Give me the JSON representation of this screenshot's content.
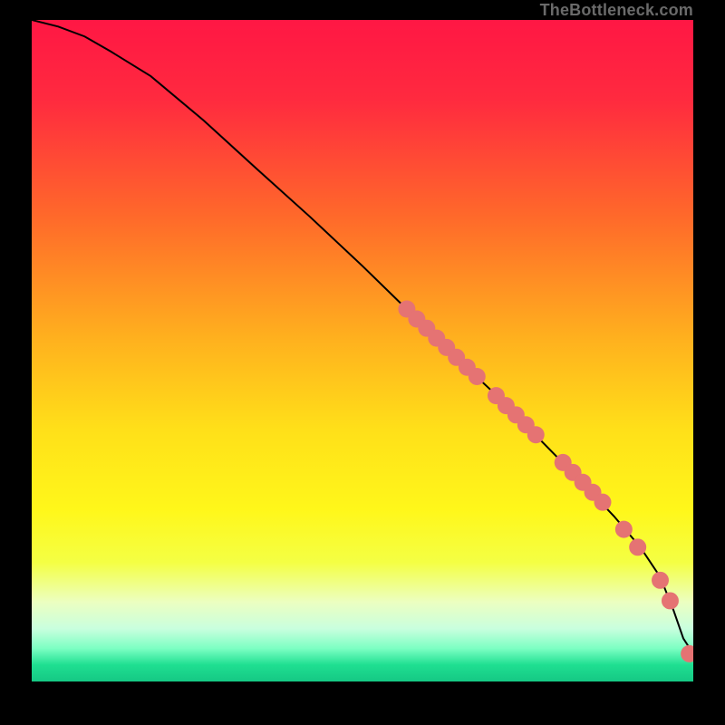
{
  "watermark": "TheBottleneck.com",
  "chart_data": {
    "type": "line",
    "title": "",
    "xlabel": "",
    "ylabel": "",
    "xlim": [
      0,
      100
    ],
    "ylim": [
      0,
      100
    ],
    "grid": false,
    "legend": false,
    "gradient_stops": [
      {
        "pos": 0.0,
        "color": "#ff1744"
      },
      {
        "pos": 0.12,
        "color": "#ff2a3f"
      },
      {
        "pos": 0.3,
        "color": "#ff6a2a"
      },
      {
        "pos": 0.48,
        "color": "#ffb01e"
      },
      {
        "pos": 0.62,
        "color": "#ffe019"
      },
      {
        "pos": 0.74,
        "color": "#fff71a"
      },
      {
        "pos": 0.82,
        "color": "#f4ff44"
      },
      {
        "pos": 0.88,
        "color": "#ecffc1"
      },
      {
        "pos": 0.92,
        "color": "#c9ffde"
      },
      {
        "pos": 0.95,
        "color": "#7cffc3"
      },
      {
        "pos": 0.975,
        "color": "#1fdf91"
      },
      {
        "pos": 1.0,
        "color": "#15c884"
      }
    ],
    "curve": {
      "x": [
        0,
        4,
        8,
        12,
        18,
        26,
        34,
        42,
        50,
        58,
        64,
        70,
        76,
        82,
        88,
        92,
        95,
        97,
        98.5,
        100
      ],
      "y": [
        100,
        99,
        97.5,
        95.2,
        91.5,
        84.8,
        77.5,
        70.3,
        62.8,
        55.0,
        49.1,
        43.5,
        37.4,
        31.3,
        25.0,
        20.3,
        15.8,
        10.8,
        6.5,
        4.2
      ]
    },
    "marker_color": "#e57373",
    "marker_radius_pct": 1.3,
    "markers": [
      {
        "x": 56.7,
        "y": 56.3
      },
      {
        "x": 58.2,
        "y": 54.8
      },
      {
        "x": 59.7,
        "y": 53.4
      },
      {
        "x": 61.2,
        "y": 51.9
      },
      {
        "x": 62.7,
        "y": 50.5
      },
      {
        "x": 64.2,
        "y": 49.0
      },
      {
        "x": 65.8,
        "y": 47.5
      },
      {
        "x": 67.3,
        "y": 46.1
      },
      {
        "x": 70.2,
        "y": 43.2
      },
      {
        "x": 71.7,
        "y": 41.7
      },
      {
        "x": 73.2,
        "y": 40.3
      },
      {
        "x": 74.7,
        "y": 38.8
      },
      {
        "x": 76.2,
        "y": 37.3
      },
      {
        "x": 80.3,
        "y": 33.1
      },
      {
        "x": 81.8,
        "y": 31.6
      },
      {
        "x": 83.3,
        "y": 30.1
      },
      {
        "x": 84.8,
        "y": 28.6
      },
      {
        "x": 86.3,
        "y": 27.1
      },
      {
        "x": 89.5,
        "y": 23.0
      },
      {
        "x": 91.6,
        "y": 20.3
      },
      {
        "x": 95.0,
        "y": 15.3
      },
      {
        "x": 96.5,
        "y": 12.2
      },
      {
        "x": 99.4,
        "y": 4.2
      },
      {
        "x": 101.0,
        "y": 4.3
      }
    ]
  }
}
